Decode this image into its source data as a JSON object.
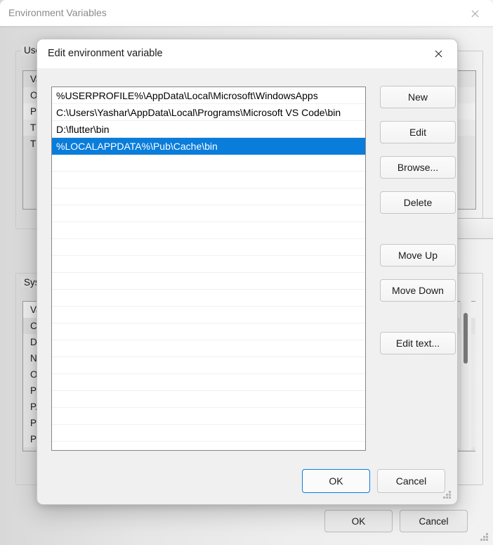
{
  "background_window": {
    "title": "Environment Variables",
    "close_icon": "close-icon",
    "user_group": {
      "label": "User",
      "rows": [
        "Va",
        "On",
        "Pa",
        "TE",
        "TM"
      ]
    },
    "system_group": {
      "label": "Syste",
      "rows": [
        "Va",
        "Co",
        "Dr",
        "NU",
        "OS",
        "Pa",
        "PA",
        "PR",
        "PR"
      ]
    },
    "buttons": {
      "ok": "OK",
      "cancel": "Cancel"
    }
  },
  "dialog": {
    "title": "Edit environment variable",
    "close_icon": "close-icon",
    "paths": [
      "%USERPROFILE%\\AppData\\Local\\Microsoft\\WindowsApps",
      "C:\\Users\\Yashar\\AppData\\Local\\Programs\\Microsoft VS Code\\bin",
      "D:\\flutter\\bin",
      "%LOCALAPPDATA%\\Pub\\Cache\\bin"
    ],
    "selected_index": 3,
    "side_buttons": {
      "new": "New",
      "edit": "Edit",
      "browse": "Browse...",
      "delete": "Delete",
      "move_up": "Move Up",
      "move_down": "Move Down",
      "edit_text": "Edit text..."
    },
    "footer_buttons": {
      "ok": "OK",
      "cancel": "Cancel"
    },
    "accent_color": "#0a7ddb"
  }
}
